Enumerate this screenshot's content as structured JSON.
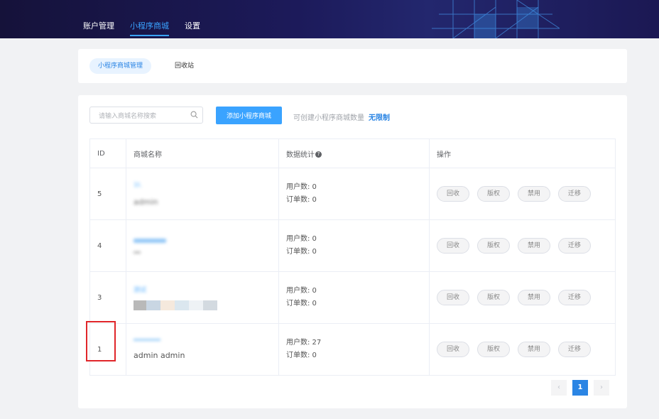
{
  "nav": {
    "items": [
      {
        "label": "账户管理",
        "active": false
      },
      {
        "label": "小程序商城",
        "active": true
      },
      {
        "label": "设置",
        "active": false
      }
    ]
  },
  "subtabs": [
    {
      "label": "小程序商城管理",
      "active": true
    },
    {
      "label": "回收站",
      "active": false
    }
  ],
  "toolbar": {
    "search_placeholder": "请输入商城名称搜索",
    "add_label": "添加小程序商城",
    "quota_label": "可创建小程序商城数量",
    "quota_value": "无限制"
  },
  "table": {
    "headers": {
      "id": "ID",
      "name": "商城名称",
      "stats": "数据统计",
      "ops": "操作"
    },
    "rows": [
      {
        "id": "5",
        "name_top": "1t.",
        "name_sub": "admin",
        "users": "用户数: 0",
        "orders": "订单数: 0"
      },
      {
        "id": "4",
        "name_top": "",
        "name_sub": "",
        "users": "用户数: 0",
        "orders": "订单数: 0"
      },
      {
        "id": "3",
        "name_top": "测试",
        "name_sub": "",
        "users": "用户数: 0",
        "orders": "订单数: 0"
      },
      {
        "id": "1",
        "name_top": "",
        "name_sub": "admin admin",
        "users": "用户数: 27",
        "orders": "订单数: 0"
      }
    ],
    "op_labels": {
      "recycle": "回收",
      "copyright": "版权",
      "disable": "禁用",
      "migrate": "迁移"
    }
  },
  "pager": {
    "prev": "‹",
    "current": "1",
    "next": "›"
  },
  "colors": {
    "accent": "#3aa3ff",
    "highlight": "#e0262a",
    "header_bg": "#1c1a5a"
  }
}
